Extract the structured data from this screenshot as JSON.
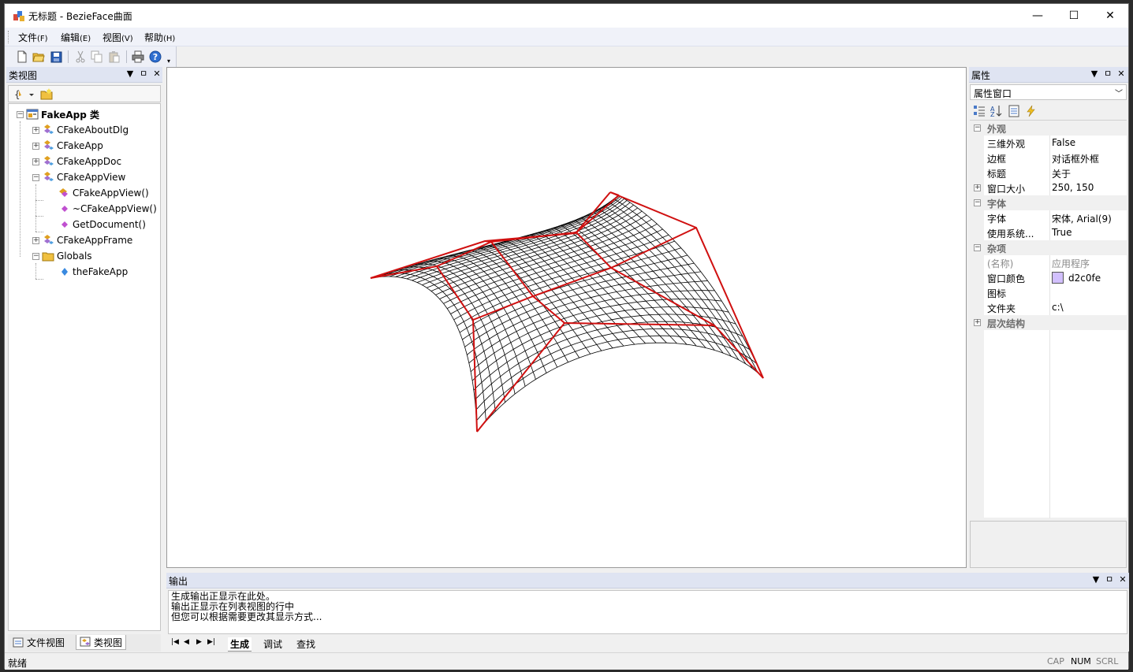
{
  "window": {
    "title": "无标题 - BezieFace曲面",
    "buttons": {
      "minimize": "—",
      "maximize": "☐",
      "close": "✕"
    }
  },
  "menu": [
    {
      "label": "文件",
      "accel": "(F)"
    },
    {
      "label": "编辑",
      "accel": "(E)"
    },
    {
      "label": "视图",
      "accel": "(V)"
    },
    {
      "label": "帮助",
      "accel": "(H)"
    }
  ],
  "toolbar": {
    "icons": [
      "new-file-icon",
      "open-folder-icon",
      "save-icon",
      "cut-icon",
      "copy-icon",
      "paste-icon",
      "print-icon",
      "help-icon"
    ]
  },
  "class_view": {
    "title": "类视图",
    "tree": [
      {
        "label": "FakeApp 类",
        "bold": true
      },
      {
        "label": "CFakeAboutDlg"
      },
      {
        "label": "CFakeApp"
      },
      {
        "label": "CFakeAppDoc"
      },
      {
        "label": "CFakeAppView"
      },
      {
        "label": "CFakeAppView()"
      },
      {
        "label": "~CFakeAppView()"
      },
      {
        "label": "GetDocument()"
      },
      {
        "label": "CFakeAppFrame"
      },
      {
        "label": "Globals"
      },
      {
        "label": "theFakeApp"
      }
    ],
    "tabs": [
      "文件视图",
      "类视图"
    ]
  },
  "properties": {
    "title": "属性",
    "selector": "属性窗口",
    "rows": [
      {
        "type": "cat",
        "name": "外观",
        "exp": "⊟"
      },
      {
        "type": "prop",
        "name": "三维外观",
        "value": "False"
      },
      {
        "type": "prop",
        "name": "边框",
        "value": "对话框外框"
      },
      {
        "type": "prop",
        "name": "标题",
        "value": "关于"
      },
      {
        "type": "prop",
        "name": "窗口大小",
        "value": "250, 150",
        "exp": "⊞"
      },
      {
        "type": "cat",
        "name": "字体",
        "exp": "⊟"
      },
      {
        "type": "prop",
        "name": "字体",
        "value": "宋体, Arial(9)"
      },
      {
        "type": "prop",
        "name": "使用系统...",
        "value": "True"
      },
      {
        "type": "cat",
        "name": "杂项",
        "exp": "⊟"
      },
      {
        "type": "prop",
        "name": "(名称)",
        "value": "应用程序",
        "gray": true
      },
      {
        "type": "prop",
        "name": "窗口颜色",
        "value": "d2c0fe",
        "swatch": "#d2c0fe"
      },
      {
        "type": "prop",
        "name": "图标",
        "value": ""
      },
      {
        "type": "prop",
        "name": "文件夹",
        "value": "c:\\"
      },
      {
        "type": "cat",
        "name": "层次结构",
        "exp": "⊞"
      }
    ]
  },
  "output": {
    "title": "输出",
    "lines": [
      "生成输出正显示在此处。",
      "输出正显示在列表视图的行中",
      "但您可以根据需要更改其显示方式..."
    ],
    "tabs": [
      "生成",
      "调试",
      "查找"
    ]
  },
  "status": {
    "text": "就绪",
    "indicators": [
      "CAP",
      "NUM",
      "SCRL"
    ]
  },
  "colors": {
    "surface_wire": "#000000",
    "control_net": "#d01010",
    "background": "#ffffff"
  }
}
